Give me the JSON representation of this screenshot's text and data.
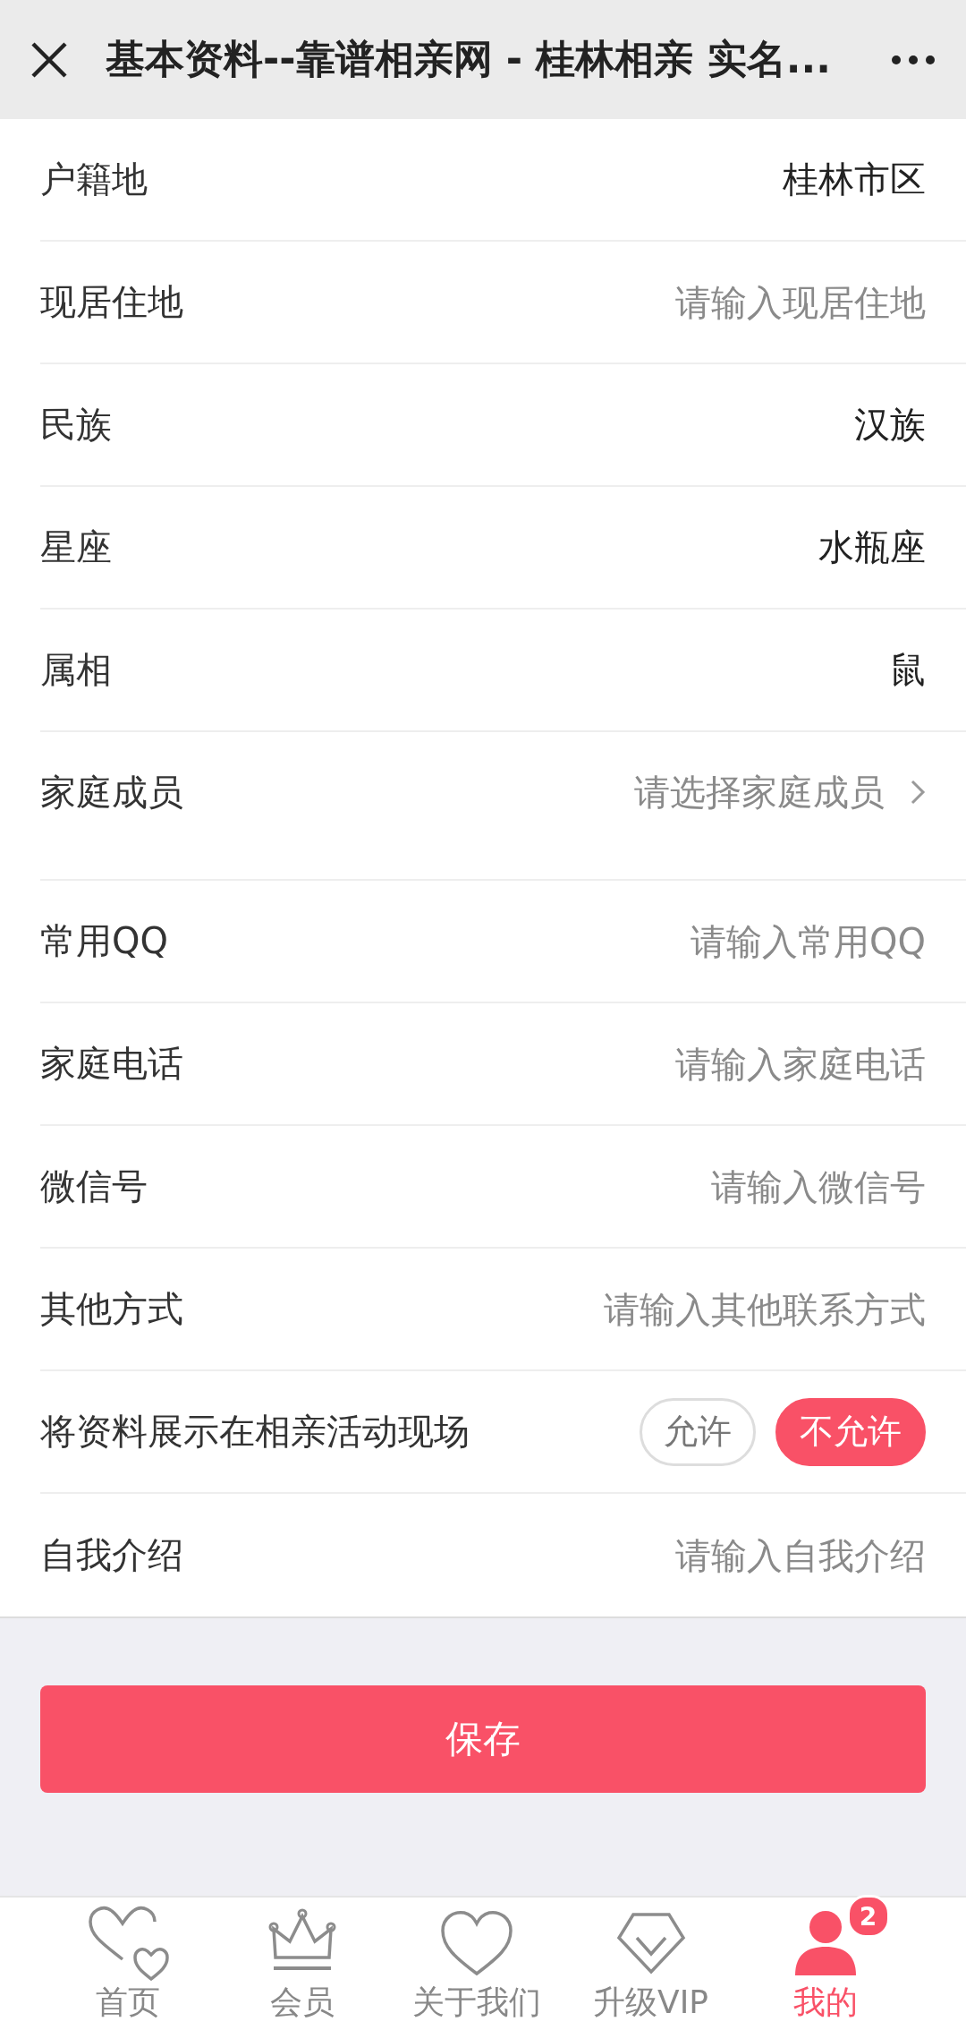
{
  "header": {
    "title": "基本资料--靠谱相亲网 - 桂林相亲 实名..."
  },
  "rows": [
    {
      "kind": "value",
      "label": "户籍地",
      "value": "桂林市区"
    },
    {
      "kind": "input",
      "label": "现居住地",
      "placeholder": "请输入现居住地"
    },
    {
      "kind": "value",
      "label": "民族",
      "value": "汉族"
    },
    {
      "kind": "value",
      "label": "星座",
      "value": "水瓶座"
    },
    {
      "kind": "value",
      "label": "属相",
      "value": "鼠"
    },
    {
      "kind": "select",
      "label": "家庭成员",
      "placeholder": "请选择家庭成员"
    },
    {
      "kind": "input",
      "label": "常用QQ",
      "placeholder": "请输入常用QQ"
    },
    {
      "kind": "input",
      "label": "家庭电话",
      "placeholder": "请输入家庭电话"
    },
    {
      "kind": "input",
      "label": "微信号",
      "placeholder": "请输入微信号"
    },
    {
      "kind": "input",
      "label": "其他方式",
      "placeholder": "请输入其他联系方式"
    },
    {
      "kind": "toggle",
      "label": "将资料展示在相亲活动现场",
      "options": [
        {
          "label": "允许",
          "selected": false
        },
        {
          "label": "不允许",
          "selected": true
        }
      ]
    },
    {
      "kind": "input",
      "label": "自我介绍",
      "placeholder": "请输入自我介绍"
    }
  ],
  "save_button": "保存",
  "tabs": [
    {
      "kind": "hearts",
      "label": "首页",
      "selected": false
    },
    {
      "kind": "crown",
      "label": "会员",
      "selected": false
    },
    {
      "kind": "heart",
      "label": "关于我们",
      "selected": false
    },
    {
      "kind": "diamond",
      "label": "升级VIP",
      "selected": false
    },
    {
      "kind": "person",
      "label": "我的",
      "selected": true,
      "badge": "2"
    }
  ]
}
